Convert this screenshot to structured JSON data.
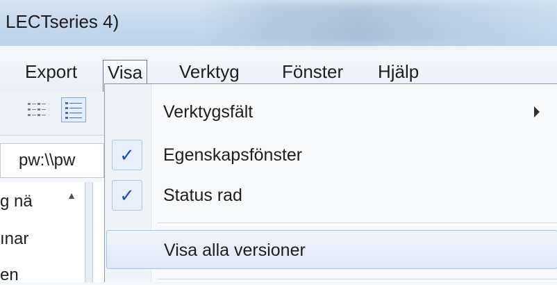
{
  "window": {
    "title": "LECTseries 4)"
  },
  "menubar": {
    "items": [
      {
        "label": "Export"
      },
      {
        "label": "Visa"
      },
      {
        "label": "Verktyg"
      },
      {
        "label": "Fönster"
      },
      {
        "label": "Hjälp"
      }
    ]
  },
  "address": {
    "value": "pw:\\\\pw"
  },
  "list": {
    "rows": [
      "g nä",
      "ınar",
      "en"
    ]
  },
  "dropdown": {
    "items": [
      {
        "label": "Verktygsfält",
        "checked": false,
        "submenu": true
      },
      {
        "label": "Egenskapsfönster",
        "checked": true
      },
      {
        "label": "Status rad",
        "checked": true
      },
      {
        "label": "Visa alla versioner",
        "checked": false,
        "highlighted": true
      }
    ],
    "check_glyph": "✓"
  },
  "colors": {
    "accent": "#1f4fa8",
    "hover_border": "#a7c3e6"
  }
}
